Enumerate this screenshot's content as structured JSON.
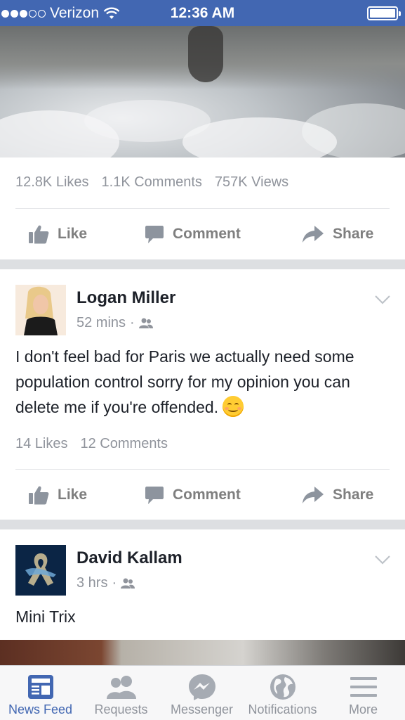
{
  "status_bar": {
    "carrier": "Verizon",
    "time": "12:36 AM",
    "signal_dots_filled": 3,
    "signal_dots_total": 5,
    "battery_level": 1.0
  },
  "video_post": {
    "likes": "12.8K Likes",
    "comments": "1.1K Comments",
    "views": "757K Views",
    "actions": {
      "like": "Like",
      "comment": "Comment",
      "share": "Share"
    }
  },
  "post_logan": {
    "author": "Logan Miller",
    "time": "52 mins",
    "audience_icon": "friends-icon",
    "text": "I don't feel bad for Paris we actually need some population control sorry for my opinion you can delete me if you're offended.",
    "emoji": "smiling-face-icon",
    "likes": "14 Likes",
    "comments": "12 Comments",
    "actions": {
      "like": "Like",
      "comment": "Comment",
      "share": "Share"
    }
  },
  "post_david": {
    "author": "David Kallam",
    "time": "3 hrs",
    "audience_icon": "friends-icon",
    "text": "Mini Trix"
  },
  "tab_bar": {
    "tabs": [
      {
        "label": "News Feed",
        "icon": "news-feed-icon",
        "active": true
      },
      {
        "label": "Requests",
        "icon": "friend-requests-icon",
        "active": false
      },
      {
        "label": "Messenger",
        "icon": "messenger-icon",
        "active": false
      },
      {
        "label": "Notifications",
        "icon": "globe-icon",
        "active": false
      },
      {
        "label": "More",
        "icon": "menu-icon",
        "active": false
      }
    ]
  },
  "colors": {
    "brand_blue": "#4267b2",
    "secondary_text": "#90949c",
    "separator": "#dddfe2"
  }
}
